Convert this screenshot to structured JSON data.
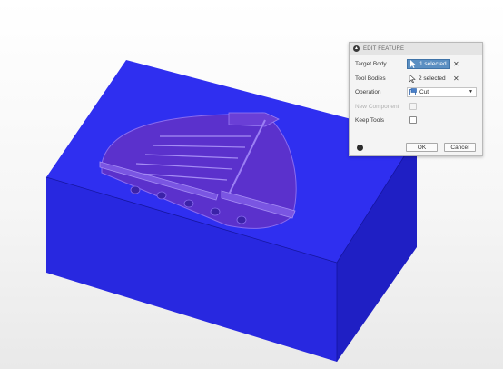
{
  "dialog": {
    "title": "EDIT FEATURE",
    "rows": {
      "target_body": {
        "label": "Target Body",
        "value": "1 selected"
      },
      "tool_bodies": {
        "label": "Tool Bodies",
        "value": "2 selected"
      },
      "operation": {
        "label": "Operation",
        "value": "Cut"
      },
      "new_component": {
        "label": "New Component",
        "checked": false,
        "enabled": false
      },
      "keep_tools": {
        "label": "Keep Tools",
        "checked": false
      }
    },
    "ok_label": "OK",
    "cancel_label": "Cancel"
  },
  "colors": {
    "body_top": "#2f2ff0",
    "body_front": "#2626dc",
    "body_side": "#1e1ec2",
    "cut_fill": "#5a2fc8",
    "accent": "#5b8fc2"
  },
  "icons": [
    "collapse-icon",
    "cursor-icon",
    "clear-icon",
    "cut-operation-icon",
    "chevron-down-icon",
    "info-icon"
  ]
}
